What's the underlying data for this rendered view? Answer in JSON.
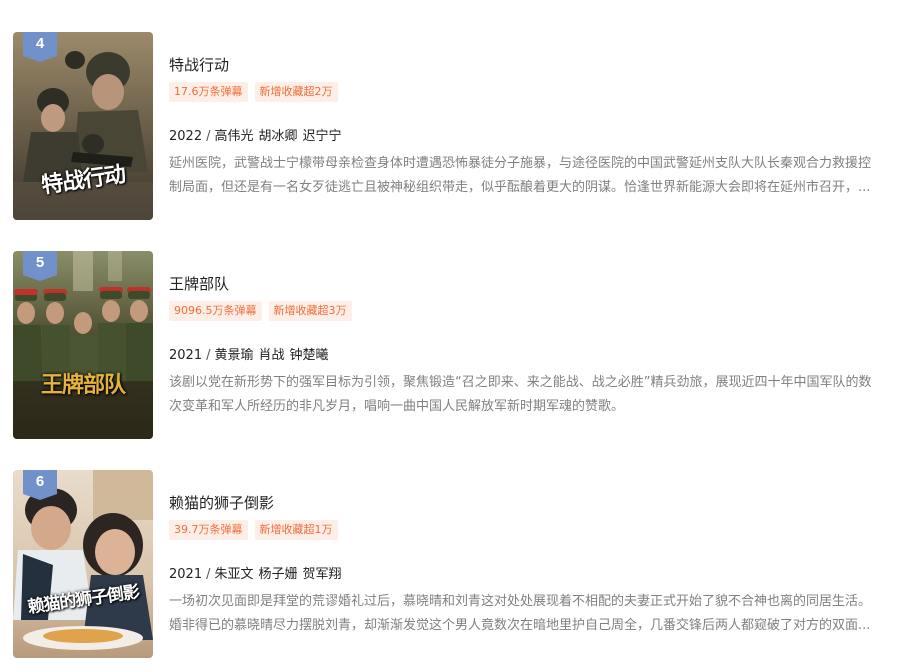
{
  "items": [
    {
      "rank": "4",
      "title": "特战行动",
      "poster_text": "特战行动",
      "danmaku": "17.6万条弹幕",
      "favorites": "新增收藏超2万",
      "year": "2022",
      "actors": [
        "高伟光",
        "胡冰卿",
        "迟宁宁"
      ],
      "desc_line1": "延州医院，武警战士宁檬带母亲检查身体时遭遇恐怖暴徒分子施暴，与途径医院的中国武警延州支队大队长秦观合力救援控",
      "desc_line2": "制局面，但还是有一名女歹徒逃亡且被神秘组织带走，似乎酝酿着更大的阴谋。恰逢世界新能源大会即将在延州市召开，..."
    },
    {
      "rank": "5",
      "title": "王牌部队",
      "poster_text": "王牌部队",
      "danmaku": "9096.5万条弹幕",
      "favorites": "新增收藏超3万",
      "year": "2021",
      "actors": [
        "黄景瑜",
        "肖战",
        "钟楚曦"
      ],
      "desc_line1": "该剧以党在新形势下的强军目标为引领，聚焦锻造“召之即来、来之能战、战之必胜”精兵劲旅，展现近四十年中国军队的数",
      "desc_line2": "次变革和军人所经历的非凡岁月，唱响一曲中国人民解放军新时期军魂的赞歌。"
    },
    {
      "rank": "6",
      "title": "赖猫的狮子倒影",
      "poster_text": "赖猫的狮子倒影",
      "danmaku": "39.7万条弹幕",
      "favorites": "新增收藏超1万",
      "year": "2021",
      "actors": [
        "朱亚文",
        "杨子姗",
        "贺军翔"
      ],
      "desc_line1": "一场初次见面即是拜堂的荒谬婚礼过后，慕晓晴和刘青这对处处展现着不相配的夫妻正式开始了貌不合神也离的同居生活。",
      "desc_line2": "婚非得已的慕晓晴尽力摆脱刘青，却渐渐发觉这个男人竟数次在暗地里护自己周全，几番交锋后两人都窥破了对方的双面..."
    }
  ],
  "colors": {
    "rank_badge": "#7290c9",
    "tag_text": "#f26d3a",
    "tag_bg": "#fdeee7",
    "title": "#222222",
    "desc": "#808080"
  }
}
